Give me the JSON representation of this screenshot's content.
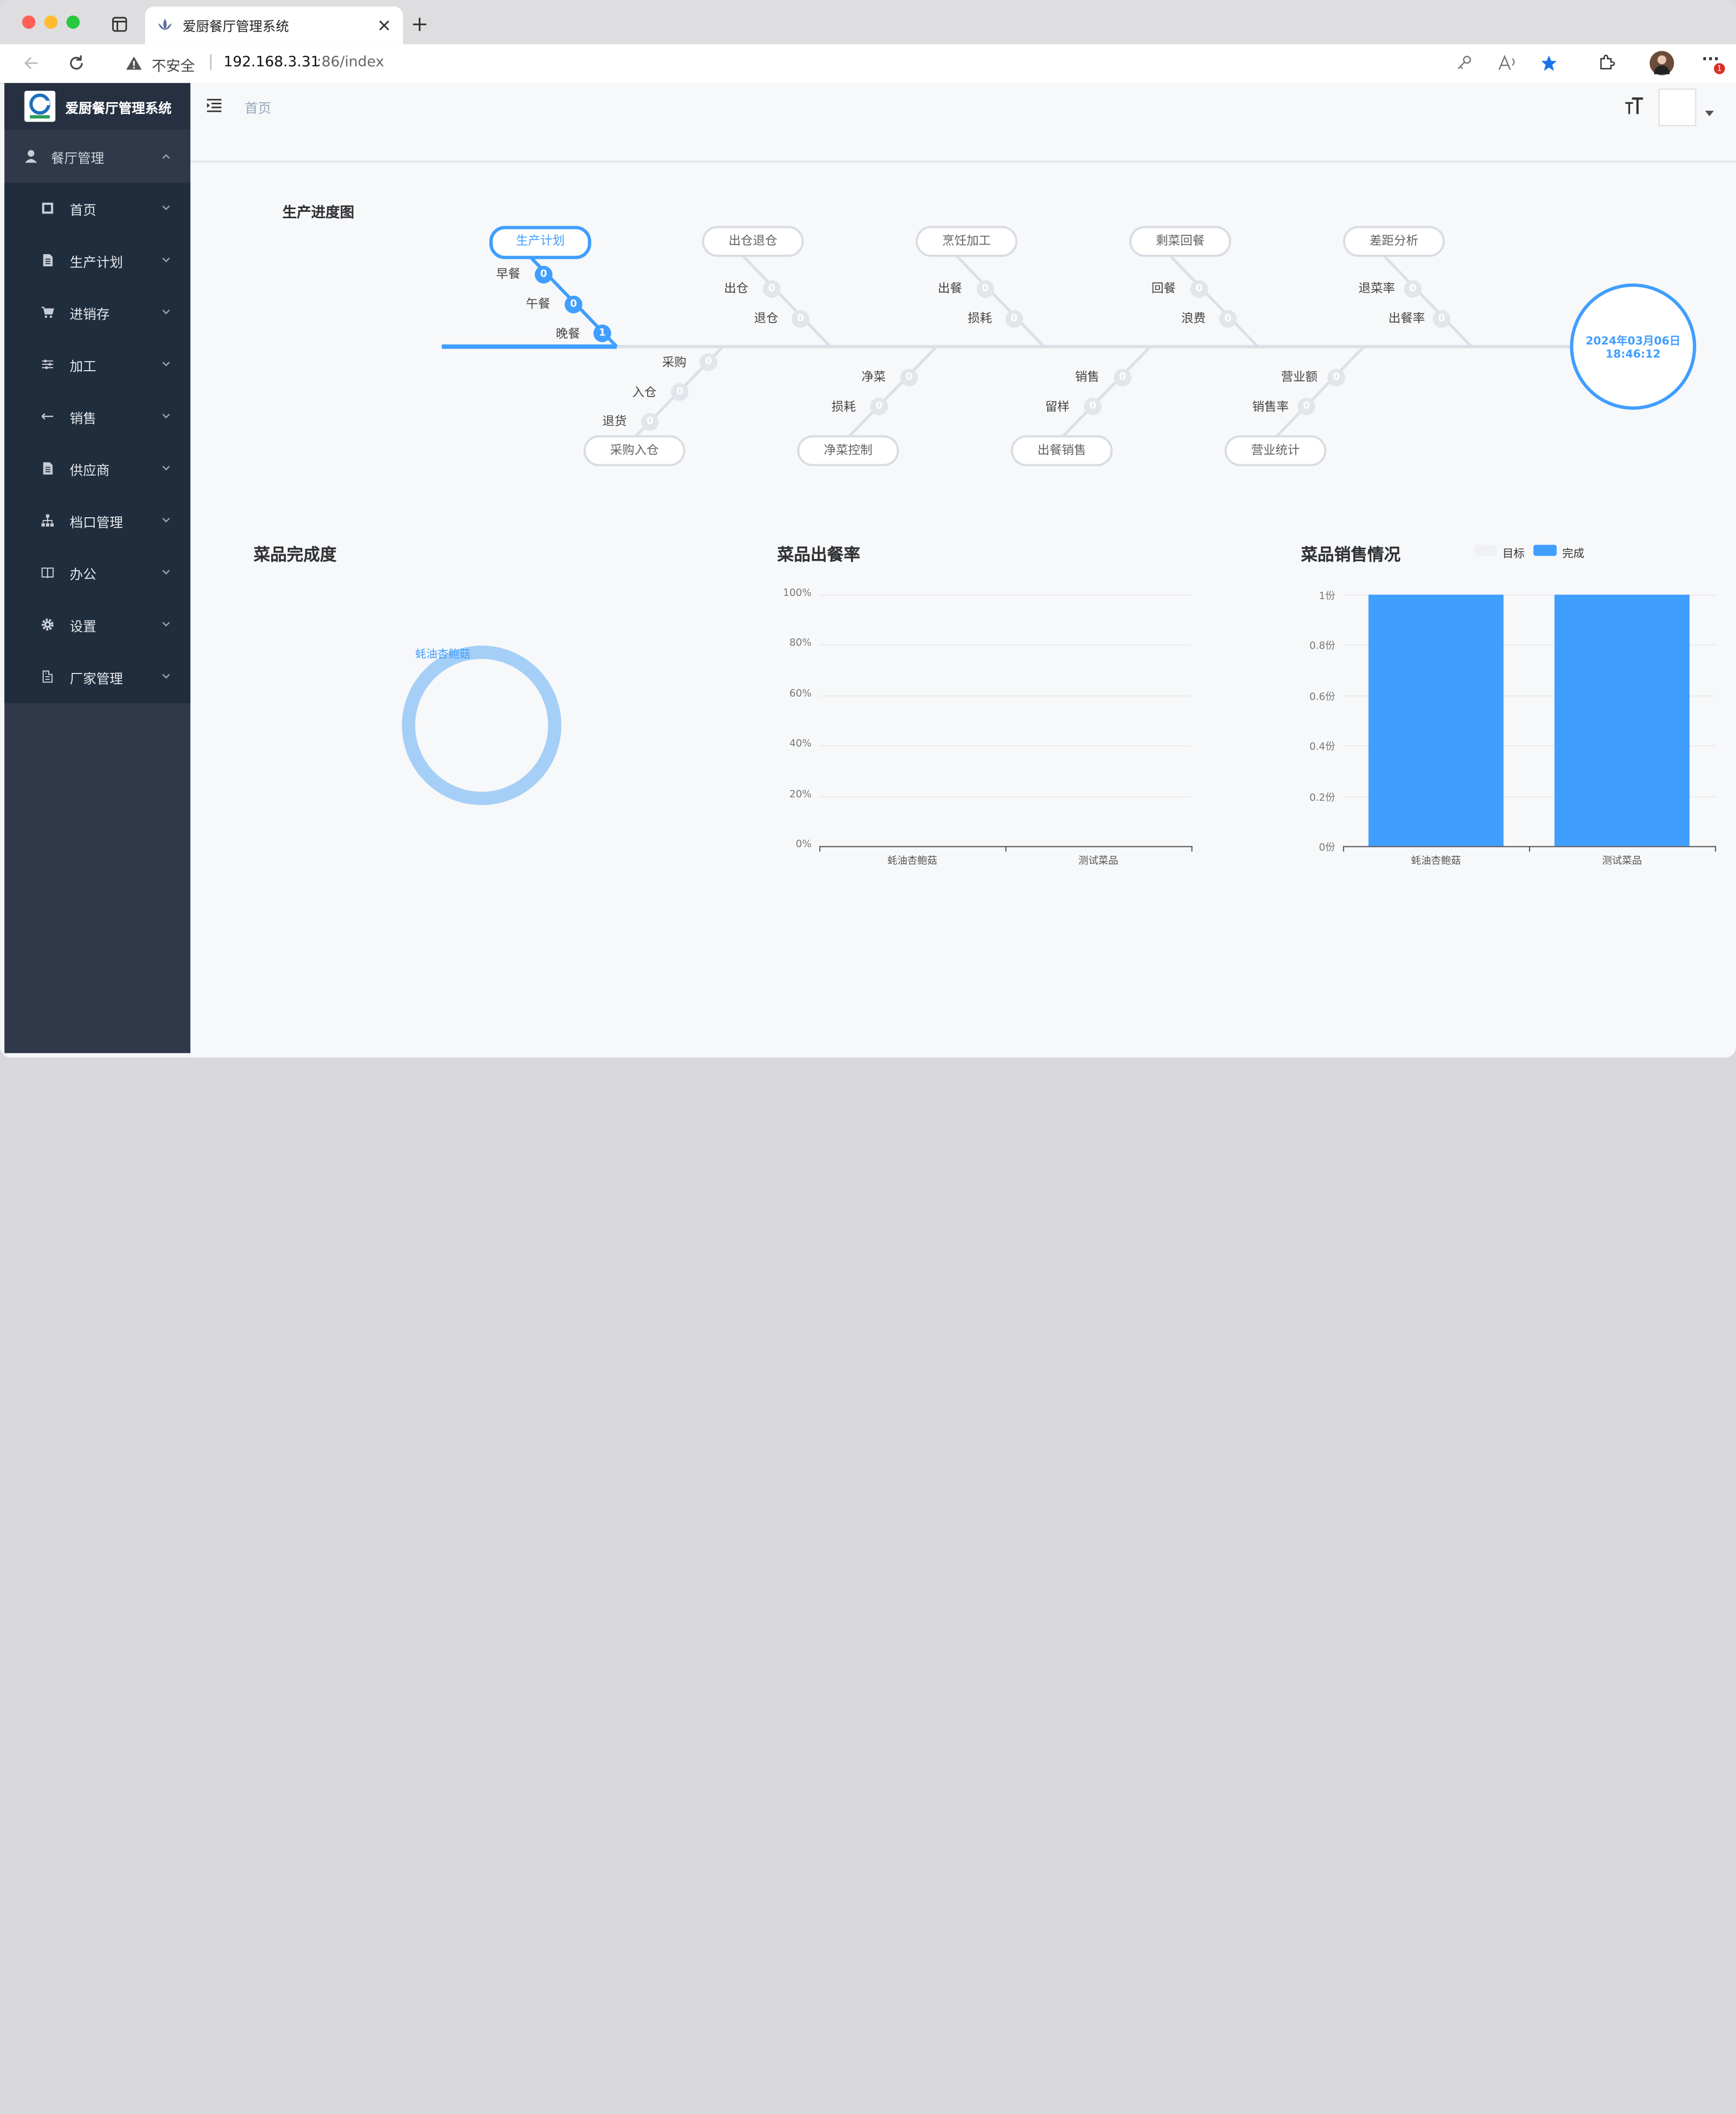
{
  "browser": {
    "tab_title": "爱厨餐厅管理系统",
    "security_label": "不安全",
    "url_host": "192.168.3.31",
    "url_rest": ":86/index",
    "notification_count": "1"
  },
  "sidebar": {
    "brand": "爱厨餐厅管理系统",
    "group_label": "餐厅管理",
    "items": [
      {
        "label": "首页",
        "icon": "film-icon"
      },
      {
        "label": "生产计划",
        "icon": "document-icon"
      },
      {
        "label": "进销存",
        "icon": "cart-icon"
      },
      {
        "label": "加工",
        "icon": "sliders-icon"
      },
      {
        "label": "销售",
        "icon": "arrow-icon"
      },
      {
        "label": "供应商",
        "icon": "document-icon"
      },
      {
        "label": "档口管理",
        "icon": "org-chart-icon"
      },
      {
        "label": "办公",
        "icon": "book-icon"
      },
      {
        "label": "设置",
        "icon": "gear-icon"
      },
      {
        "label": "厂家管理",
        "icon": "factory-icon"
      }
    ]
  },
  "header": {
    "breadcrumb": "首页"
  },
  "progress": {
    "title": "生产进度图",
    "top_tags": [
      "生产计划",
      "出仓退仓",
      "烹饪加工",
      "剩菜回餐",
      "差距分析"
    ],
    "bottom_tags": [
      "采购入仓",
      "净菜控制",
      "出餐销售",
      "营业统计"
    ],
    "plan_branches": [
      {
        "label": "早餐",
        "value": "0"
      },
      {
        "label": "午餐",
        "value": "0"
      },
      {
        "label": "晚餐",
        "value": "1"
      }
    ],
    "top_branches": [
      [
        {
          "label": "出仓",
          "value": "0"
        },
        {
          "label": "退仓",
          "value": "0"
        }
      ],
      [
        {
          "label": "出餐",
          "value": "0"
        },
        {
          "label": "损耗",
          "value": "0"
        }
      ],
      [
        {
          "label": "回餐",
          "value": "0"
        },
        {
          "label": "浪费",
          "value": "0"
        }
      ],
      [
        {
          "label": "退菜率",
          "value": "0"
        },
        {
          "label": "出餐率",
          "value": "0"
        }
      ]
    ],
    "bottom_branches": [
      [
        {
          "label": "采购",
          "value": "0"
        },
        {
          "label": "入仓",
          "value": "0"
        },
        {
          "label": "退货",
          "value": "0"
        }
      ],
      [
        {
          "label": "净菜",
          "value": "0"
        },
        {
          "label": "损耗",
          "value": "0"
        }
      ],
      [
        {
          "label": "销售",
          "value": "0"
        },
        {
          "label": "留样",
          "value": "0"
        }
      ],
      [
        {
          "label": "营业额",
          "value": "0"
        },
        {
          "label": "销售率",
          "value": "0"
        }
      ]
    ],
    "head_date": "2024年03月06日",
    "head_time": "18:46:12"
  },
  "chart_data": [
    {
      "type": "pie",
      "title": "菜品完成度",
      "categories": [
        "蚝油杏鲍菇"
      ],
      "values": [
        1
      ]
    },
    {
      "type": "bar",
      "title": "菜品出餐率",
      "categories": [
        "蚝油杏鲍菇",
        "测试菜品"
      ],
      "values": [
        0,
        0
      ],
      "yticks": [
        "0%",
        "20%",
        "40%",
        "60%",
        "80%",
        "100%"
      ],
      "ylim": [
        0,
        100
      ]
    },
    {
      "type": "bar",
      "title": "菜品销售情况",
      "categories": [
        "蚝油杏鲍菇",
        "测试菜品"
      ],
      "series": [
        {
          "name": "目标",
          "values": [
            0,
            0
          ],
          "color": "#f0f1f3"
        },
        {
          "name": "完成",
          "values": [
            1,
            1
          ],
          "color": "#409eff"
        }
      ],
      "yticks": [
        "0份",
        "0.2份",
        "0.4份",
        "0.6份",
        "0.8份",
        "1份"
      ],
      "ylim": [
        0,
        1
      ],
      "legend": "top"
    }
  ],
  "colors": {
    "accent": "#409eff",
    "sidebar": "#30394a",
    "submenu": "#1f2d3d"
  }
}
